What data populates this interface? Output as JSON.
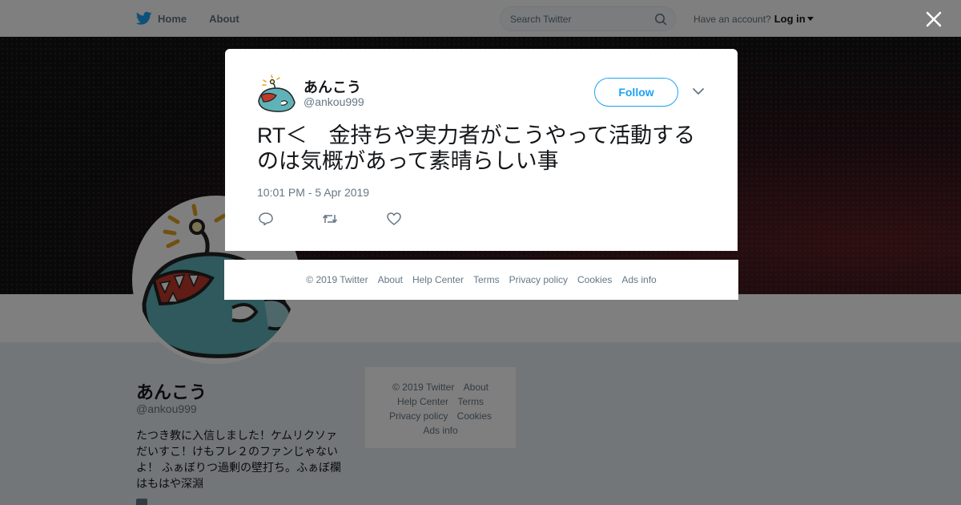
{
  "nav": {
    "home_label": "Home",
    "about_label": "About",
    "search_placeholder": "Search Twitter",
    "account_prompt": "Have an account?",
    "login_label": "Log in"
  },
  "profile": {
    "name": "あんこう",
    "handle": "@ankou999",
    "bio": "たつき教に入信しました！ケムリクソァだいすこ！けもフレ２のファンじゃないよ！ ふぁぼりつ過剰の壁打ち。ふぁぼ欄はもはや深淵"
  },
  "side_footer": {
    "copyright": "© 2019 Twitter",
    "about": "About",
    "help": "Help Center",
    "terms": "Terms",
    "privacy": "Privacy policy",
    "cookies": "Cookies",
    "ads": "Ads info"
  },
  "tweet": {
    "author_name": "あんこう",
    "author_handle": "@ankou999",
    "follow_label": "Follow",
    "text": "RT＜　金持ちや実力者がこうやって活動するのは気概があって素晴らしい事",
    "timestamp": "10:01 PM - 5 Apr 2019"
  },
  "modal_footer": {
    "copyright": "© 2019 Twitter",
    "about": "About",
    "help": "Help Center",
    "terms": "Terms",
    "privacy": "Privacy policy",
    "cookies": "Cookies",
    "ads": "Ads info"
  },
  "icons": {
    "brand": "twitter-bird-icon",
    "search": "search-icon",
    "close": "close-icon",
    "reply": "reply-icon",
    "retweet": "retweet-icon",
    "like": "heart-icon"
  },
  "colors": {
    "accent": "#1da1f2",
    "text_secondary": "#657786",
    "overlay": "rgba(0,0,0,0.5)"
  }
}
